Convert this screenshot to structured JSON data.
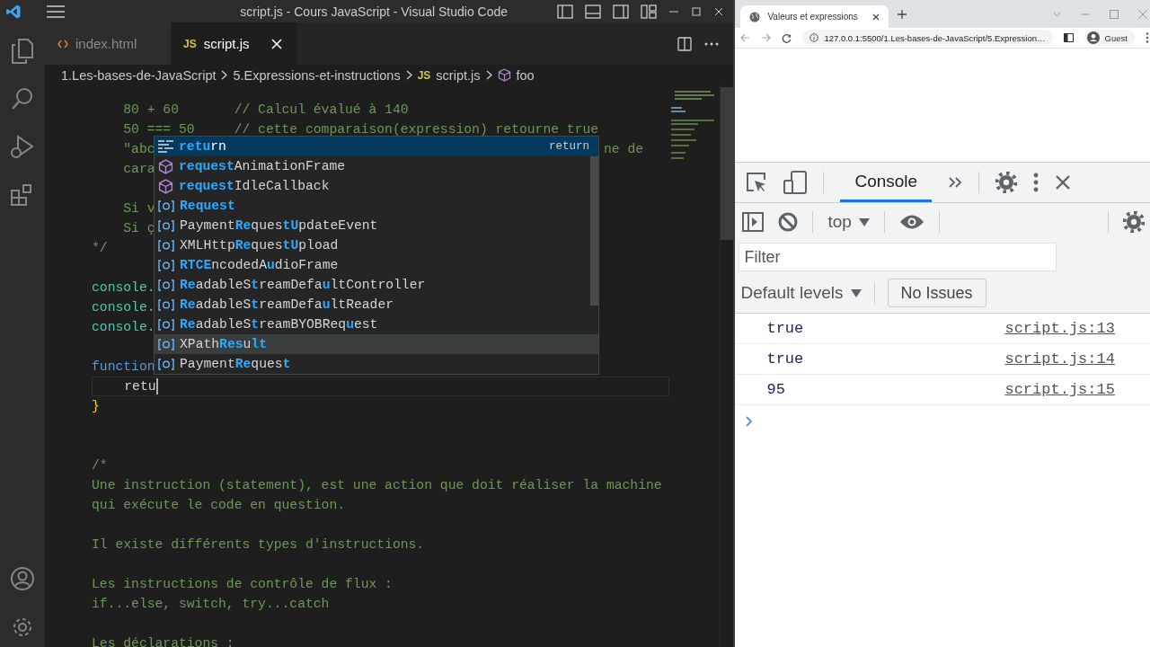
{
  "vscode": {
    "title": "script.js - Cours JavaScript - Visual Studio Code",
    "activity_bar": [
      {
        "kind": "files"
      },
      {
        "kind": "search"
      },
      {
        "kind": "run"
      },
      {
        "kind": "extensions"
      },
      {
        "kind": "account"
      },
      {
        "kind": "settings"
      }
    ],
    "tabs": [
      {
        "label": "index.html",
        "kind": "html",
        "selected": false
      },
      {
        "label": "script.js",
        "kind": "js",
        "badge": "JS",
        "selected": true
      }
    ],
    "breadcrumbs": [
      {
        "kind": "folder",
        "label": "1.Les-bases-de-JavaScript"
      },
      {
        "kind": "folder",
        "label": "5.Expressions-et-instructions"
      },
      {
        "kind": "file",
        "badge": "JS",
        "label": "script.js"
      },
      {
        "kind": "symbol",
        "label": "foo"
      }
    ],
    "code_lines": [
      {
        "kind": "comment",
        "text": "    80 + 60       // Calcul évalué à 140",
        "current": false
      },
      {
        "kind": "comment",
        "text": "    50 === 50     // cette comparaison(expression) retourne true",
        "current": false
      },
      {
        "kind": "comment",
        "text": "    \"abc",
        "tail": "ne de",
        "current": false
      },
      {
        "kind": "comment",
        "text": "    cara",
        "current": false
      },
      {
        "kind": "blank",
        "current": false
      },
      {
        "kind": "comment",
        "text": "    Si v",
        "current": false
      },
      {
        "kind": "comment",
        "text": "    Si ç",
        "current": false
      },
      {
        "kind": "comment",
        "text": "*/",
        "current": false
      },
      {
        "kind": "blank",
        "current": false
      },
      {
        "kind": "variable",
        "text": "console.",
        "current": false
      },
      {
        "kind": "variable",
        "text": "console.",
        "current": false
      },
      {
        "kind": "variable",
        "text": "console.",
        "current": false
      },
      {
        "kind": "blank",
        "current": false
      },
      {
        "kind": "keyword",
        "text": "function",
        "current": false
      },
      {
        "kind": "plain",
        "text": "    retu",
        "current": true
      },
      {
        "kind": "bracket",
        "text": "}",
        "current": false
      },
      {
        "kind": "blank",
        "current": false
      },
      {
        "kind": "blank",
        "current": false
      },
      {
        "kind": "comment",
        "text": "/*",
        "current": false
      },
      {
        "kind": "comment",
        "text": "Une instruction (statement), est une action que doit réaliser la machine",
        "current": false
      },
      {
        "kind": "comment",
        "text": "qui exécute le code en question.",
        "current": false
      },
      {
        "kind": "blank",
        "current": false
      },
      {
        "kind": "comment",
        "text": "Il existe différents types d'instructions.",
        "current": false
      },
      {
        "kind": "blank",
        "current": false
      },
      {
        "kind": "comment",
        "text": "Les instructions de contrôle de flux :",
        "current": false
      },
      {
        "kind": "comment",
        "text": "if...else, switch, try...catch",
        "current": false
      },
      {
        "kind": "blank",
        "current": false
      },
      {
        "kind": "comment",
        "text": "Les déclarations :",
        "current": false
      }
    ],
    "suggestions": [
      {
        "kind": "keyword",
        "label": "**retu**rn",
        "detail": "return",
        "selected": true,
        "hovered": false
      },
      {
        "kind": "method",
        "label": "**request**AnimationFrame",
        "selected": false,
        "hovered": false
      },
      {
        "kind": "method",
        "label": "**request**IdleCallback",
        "selected": false,
        "hovered": false
      },
      {
        "kind": "class",
        "label": "**Request**",
        "selected": false,
        "hovered": false
      },
      {
        "kind": "class",
        "label": "Payment**Re**ques**tU**pdateEvent",
        "selected": false,
        "hovered": false
      },
      {
        "kind": "class",
        "label": "XMLHttp**Re**ques**tU**pload",
        "selected": false,
        "hovered": false
      },
      {
        "kind": "class",
        "label": "**RTCE**ncodedA**u**dioFrame",
        "selected": false,
        "hovered": false
      },
      {
        "kind": "class",
        "label": "**Re**adableS**t**reamDefa**u**ltController",
        "selected": false,
        "hovered": false
      },
      {
        "kind": "class",
        "label": "**Re**adableS**t**reamDefa**u**ltReader",
        "selected": false,
        "hovered": false
      },
      {
        "kind": "class",
        "label": "**Re**adableS**t**reamBYOBReq**u**est",
        "selected": false,
        "hovered": false
      },
      {
        "kind": "class",
        "label": "XPath**Res**u**lt**",
        "selected": false,
        "hovered": true
      },
      {
        "kind": "class",
        "label": "Payment**Re**ques**t**",
        "selected": false,
        "hovered": false
      }
    ]
  },
  "browser": {
    "tab_title": "Valeurs et expressions",
    "url": "127.0.0.1:5500/1.Les-bases-de-JavaScript/5.Expression…",
    "profile": "Guest",
    "devtools": {
      "tabs": [
        {
          "label": "Console",
          "selected": true
        }
      ],
      "context": "top",
      "filter_placeholder": "Filter",
      "levels": "Default levels",
      "issues": "No Issues",
      "messages": [
        {
          "value": "true",
          "source": "script.js:13"
        },
        {
          "value": "true",
          "source": "script.js:14"
        },
        {
          "value": "95",
          "source": "script.js:15"
        }
      ]
    }
  }
}
